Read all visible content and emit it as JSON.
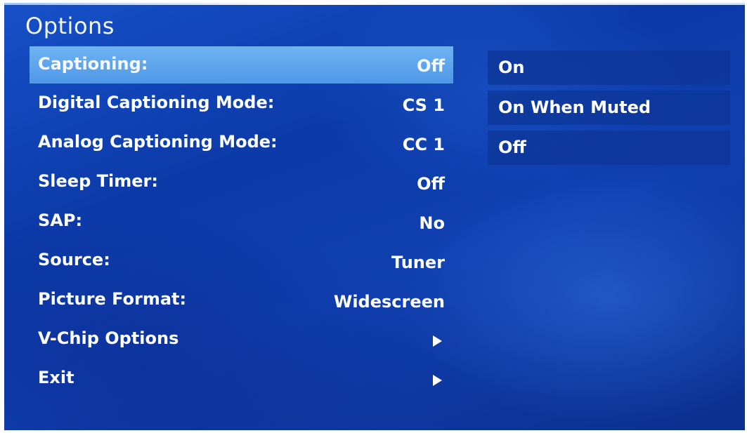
{
  "screen": {
    "title": "Options",
    "accent_color": "#4e98e6",
    "background_color": "#0c3aa8"
  },
  "menu": {
    "items": [
      {
        "label": "Captioning:",
        "value": "Off",
        "selected": true
      },
      {
        "label": "Digital Captioning Mode:",
        "value": "CS 1"
      },
      {
        "label": "Analog Captioning Mode:",
        "value": "CC 1"
      },
      {
        "label": "Sleep Timer:",
        "value": "Off"
      },
      {
        "label": "SAP:",
        "value": "No"
      },
      {
        "label": "Source:",
        "value": "Tuner"
      },
      {
        "label": "Picture Format:",
        "value": "Widescreen"
      },
      {
        "label": "V-Chip Options",
        "icon": "right-arrow-icon"
      },
      {
        "label": "Exit",
        "icon": "right-arrow-icon"
      }
    ]
  },
  "submenu": {
    "options": [
      "On",
      "On When Muted",
      "Off"
    ]
  }
}
